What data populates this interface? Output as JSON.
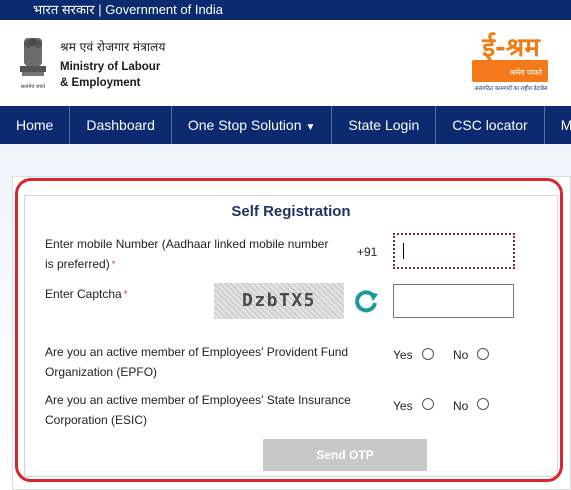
{
  "gov_strip": {
    "hindi": "भारत सरकार",
    "separator": " | ",
    "english": "Government of India"
  },
  "ministry": {
    "hindi": "श्रम एवं रोजगार मंत्रालय",
    "line1": "Ministry of Labour",
    "line2": "& Employment",
    "emblem_caption": "सत्यमेव जयते"
  },
  "logo": {
    "title": "ई-श्रम",
    "tag": "श्रमेव जयते",
    "subtitle": "असंगठित कामगारों का राष्ट्रीय डेटाबेस"
  },
  "nav": {
    "home": "Home",
    "dashboard": "Dashboard",
    "one_stop": "One Stop Solution",
    "state_login": "State Login",
    "csc_locator": "CSC locator",
    "my": "My"
  },
  "form": {
    "title": "Self Registration",
    "mobile_label_1": "Enter mobile Number (Aadhaar linked mobile number",
    "mobile_label_2": "is preferred)",
    "required_mark": "*",
    "prefix": "+91",
    "mobile_value": "",
    "captcha_label": "Enter Captcha",
    "captcha_text": "DzbTX5",
    "captcha_value": "",
    "epfo_q1": "Are you an active member of Employees' Provident Fund",
    "epfo_q2": "Organization (EPFO)",
    "esic_q1": "Are you an active member of Employees' State Insurance",
    "esic_q2": "Corporation (ESIC)",
    "yes": "Yes",
    "no": "No",
    "send_otp": "Send OTP"
  },
  "colors": {
    "navy": "#0b2a6f",
    "accent_orange": "#f07c16",
    "highlight_red": "#d8262f",
    "refresh_teal": "#1a9aa0"
  }
}
